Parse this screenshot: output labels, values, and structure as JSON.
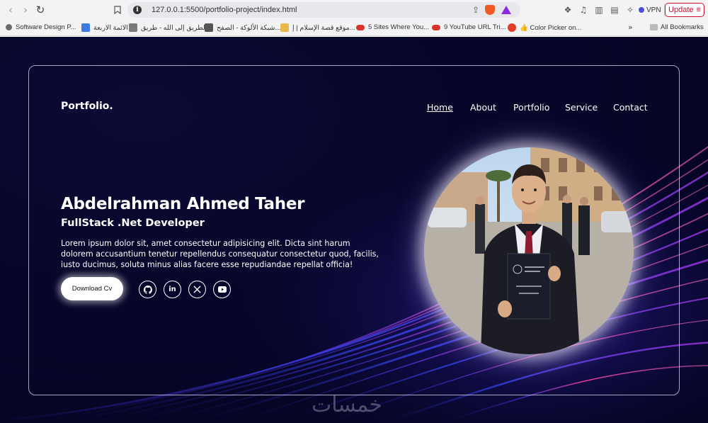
{
  "browser": {
    "url": "127.0.0.1:5500/portfolio-project/index.html",
    "vpn_label": "VPN",
    "update_label": "Update",
    "bookmarks": [
      {
        "label": "Software Design P...",
        "color": "#6b6b6b"
      },
      {
        "label": "الائمة الاربعة",
        "color": "#3b7be0"
      },
      {
        "label": "الطريق إلى الله - طريق...",
        "color": "#7a7a7a"
      },
      {
        "label": "شبكة الألوكة - الصفح...",
        "color": "#555555"
      },
      {
        "label": "موقع قصة الإسلام | إ...",
        "color": "#e8b94a"
      },
      {
        "label": "5 Sites Where You...",
        "color": "#d9342b"
      },
      {
        "label": "9 YouTube URL Tri...",
        "color": "#d9342b"
      },
      {
        "label": "👍 Color Picker on...",
        "color": "#e03b2b"
      }
    ],
    "all_bookmarks_label": "All Bookmarks"
  },
  "site": {
    "logo": "Portfolio.",
    "nav": [
      {
        "label": "Home",
        "active": true
      },
      {
        "label": "About",
        "active": false
      },
      {
        "label": "Portfolio",
        "active": false
      },
      {
        "label": "Service",
        "active": false
      },
      {
        "label": "Contact",
        "active": false
      }
    ],
    "hero": {
      "name": "Abdelrahman Ahmed Taher",
      "role": "FullStack .Net Developer",
      "description": "Lorem ipsum dolor sit, amet consectetur adipisicing elit. Dicta sint harum dolorem accusantium tenetur repellendus consequatur consectetur quod, facilis, iusto ducimus, soluta minus alias facere esse repudiandae repellat officia!",
      "cta_label": "Download Cv",
      "socials": [
        "github-icon",
        "linkedin-icon",
        "x-icon",
        "youtube-icon"
      ]
    },
    "watermark": "خمسات"
  },
  "colors": {
    "bg": "#07062a",
    "accent_pink": "#ff3fa8",
    "accent_blue": "#5a5cff",
    "update_red": "#c8102e"
  }
}
